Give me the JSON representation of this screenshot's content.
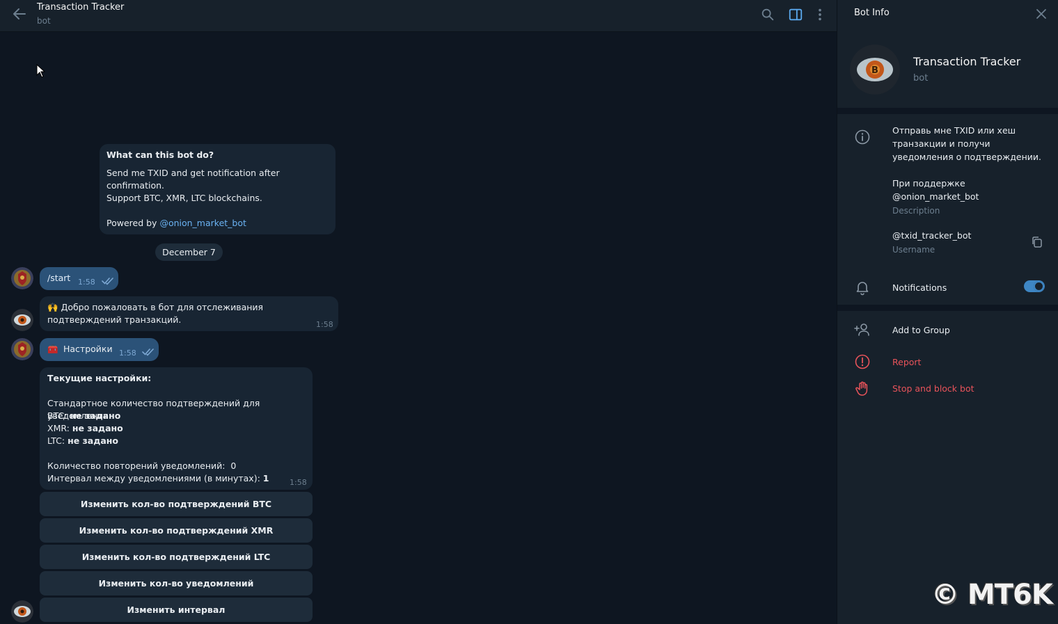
{
  "header": {
    "title": "Transaction Tracker",
    "subtitle": "bot"
  },
  "intro": {
    "heading": "What can this bot do?",
    "line1": "Send me TXID and get notification after confirmation.",
    "line2": "Support BTC, XMR, LTC blockchains.",
    "powered_prefix": "Powered by ",
    "powered_link": "@onion_market_bot"
  },
  "date_pill": "December 7",
  "messages": [
    {
      "text": "/start",
      "time": "1:58"
    },
    {
      "emoji": "🙌",
      "text": "Добро пожаловать в бот для отслеживания подтверждений транзакций.",
      "time": "1:58"
    },
    {
      "emoji": "🧰",
      "text": "Настройки",
      "time": "1:58"
    }
  ],
  "settings": {
    "heading": "Текущие настройки:",
    "subheading": "Стандартное количество подтверждений для уведомления:",
    "btc_label": "BTC: ",
    "btc_value": "не задано",
    "xmr_label": "XMR: ",
    "xmr_value": "не задано",
    "ltc_label": "LTC: ",
    "ltc_value": "не задано",
    "repeat_label": "Количество повторений уведомлений:  0",
    "interval_label": "Интервал между уведомлениями (в минутах): ",
    "interval_value": "1",
    "time": "1:58"
  },
  "keyboard": [
    "Изменить кол-во подтверждений BTC",
    "Изменить кол-во подтверждений XMR",
    "Изменить кол-во подтверждений LTC",
    "Изменить кол-во уведомлений",
    "Изменить интервал"
  ],
  "panel": {
    "title": "Bot Info",
    "name": "Transaction Tracker",
    "subtitle": "bot",
    "description": "Отправь мне TXID или хеш транзакции и получи уведомления о подтверждении.",
    "support_text": "При поддержке",
    "support_link": "@onion_market_bot",
    "description_label": "Description",
    "username": "@txid_tracker_bot",
    "username_label": "Username",
    "notifications": "Notifications",
    "notifications_on": true,
    "add_to_group": "Add to Group",
    "report": "Report",
    "stop_block": "Stop and block bot"
  },
  "watermark": "© MT6K",
  "colors": {
    "background": "#0e1621",
    "panel": "#17212b",
    "bubble_in": "#182533",
    "bubble_out": "#2b5278",
    "link": "#6ab2f2",
    "danger": "#e8535a",
    "toggle": "#3e86c4"
  },
  "icons": [
    "back-arrow-icon",
    "search-icon",
    "sidebar-toggle-icon",
    "more-vertical-icon",
    "close-icon",
    "info-icon",
    "copy-icon",
    "bell-icon",
    "add-person-icon",
    "report-icon",
    "hand-stop-icon",
    "double-check-icon"
  ]
}
